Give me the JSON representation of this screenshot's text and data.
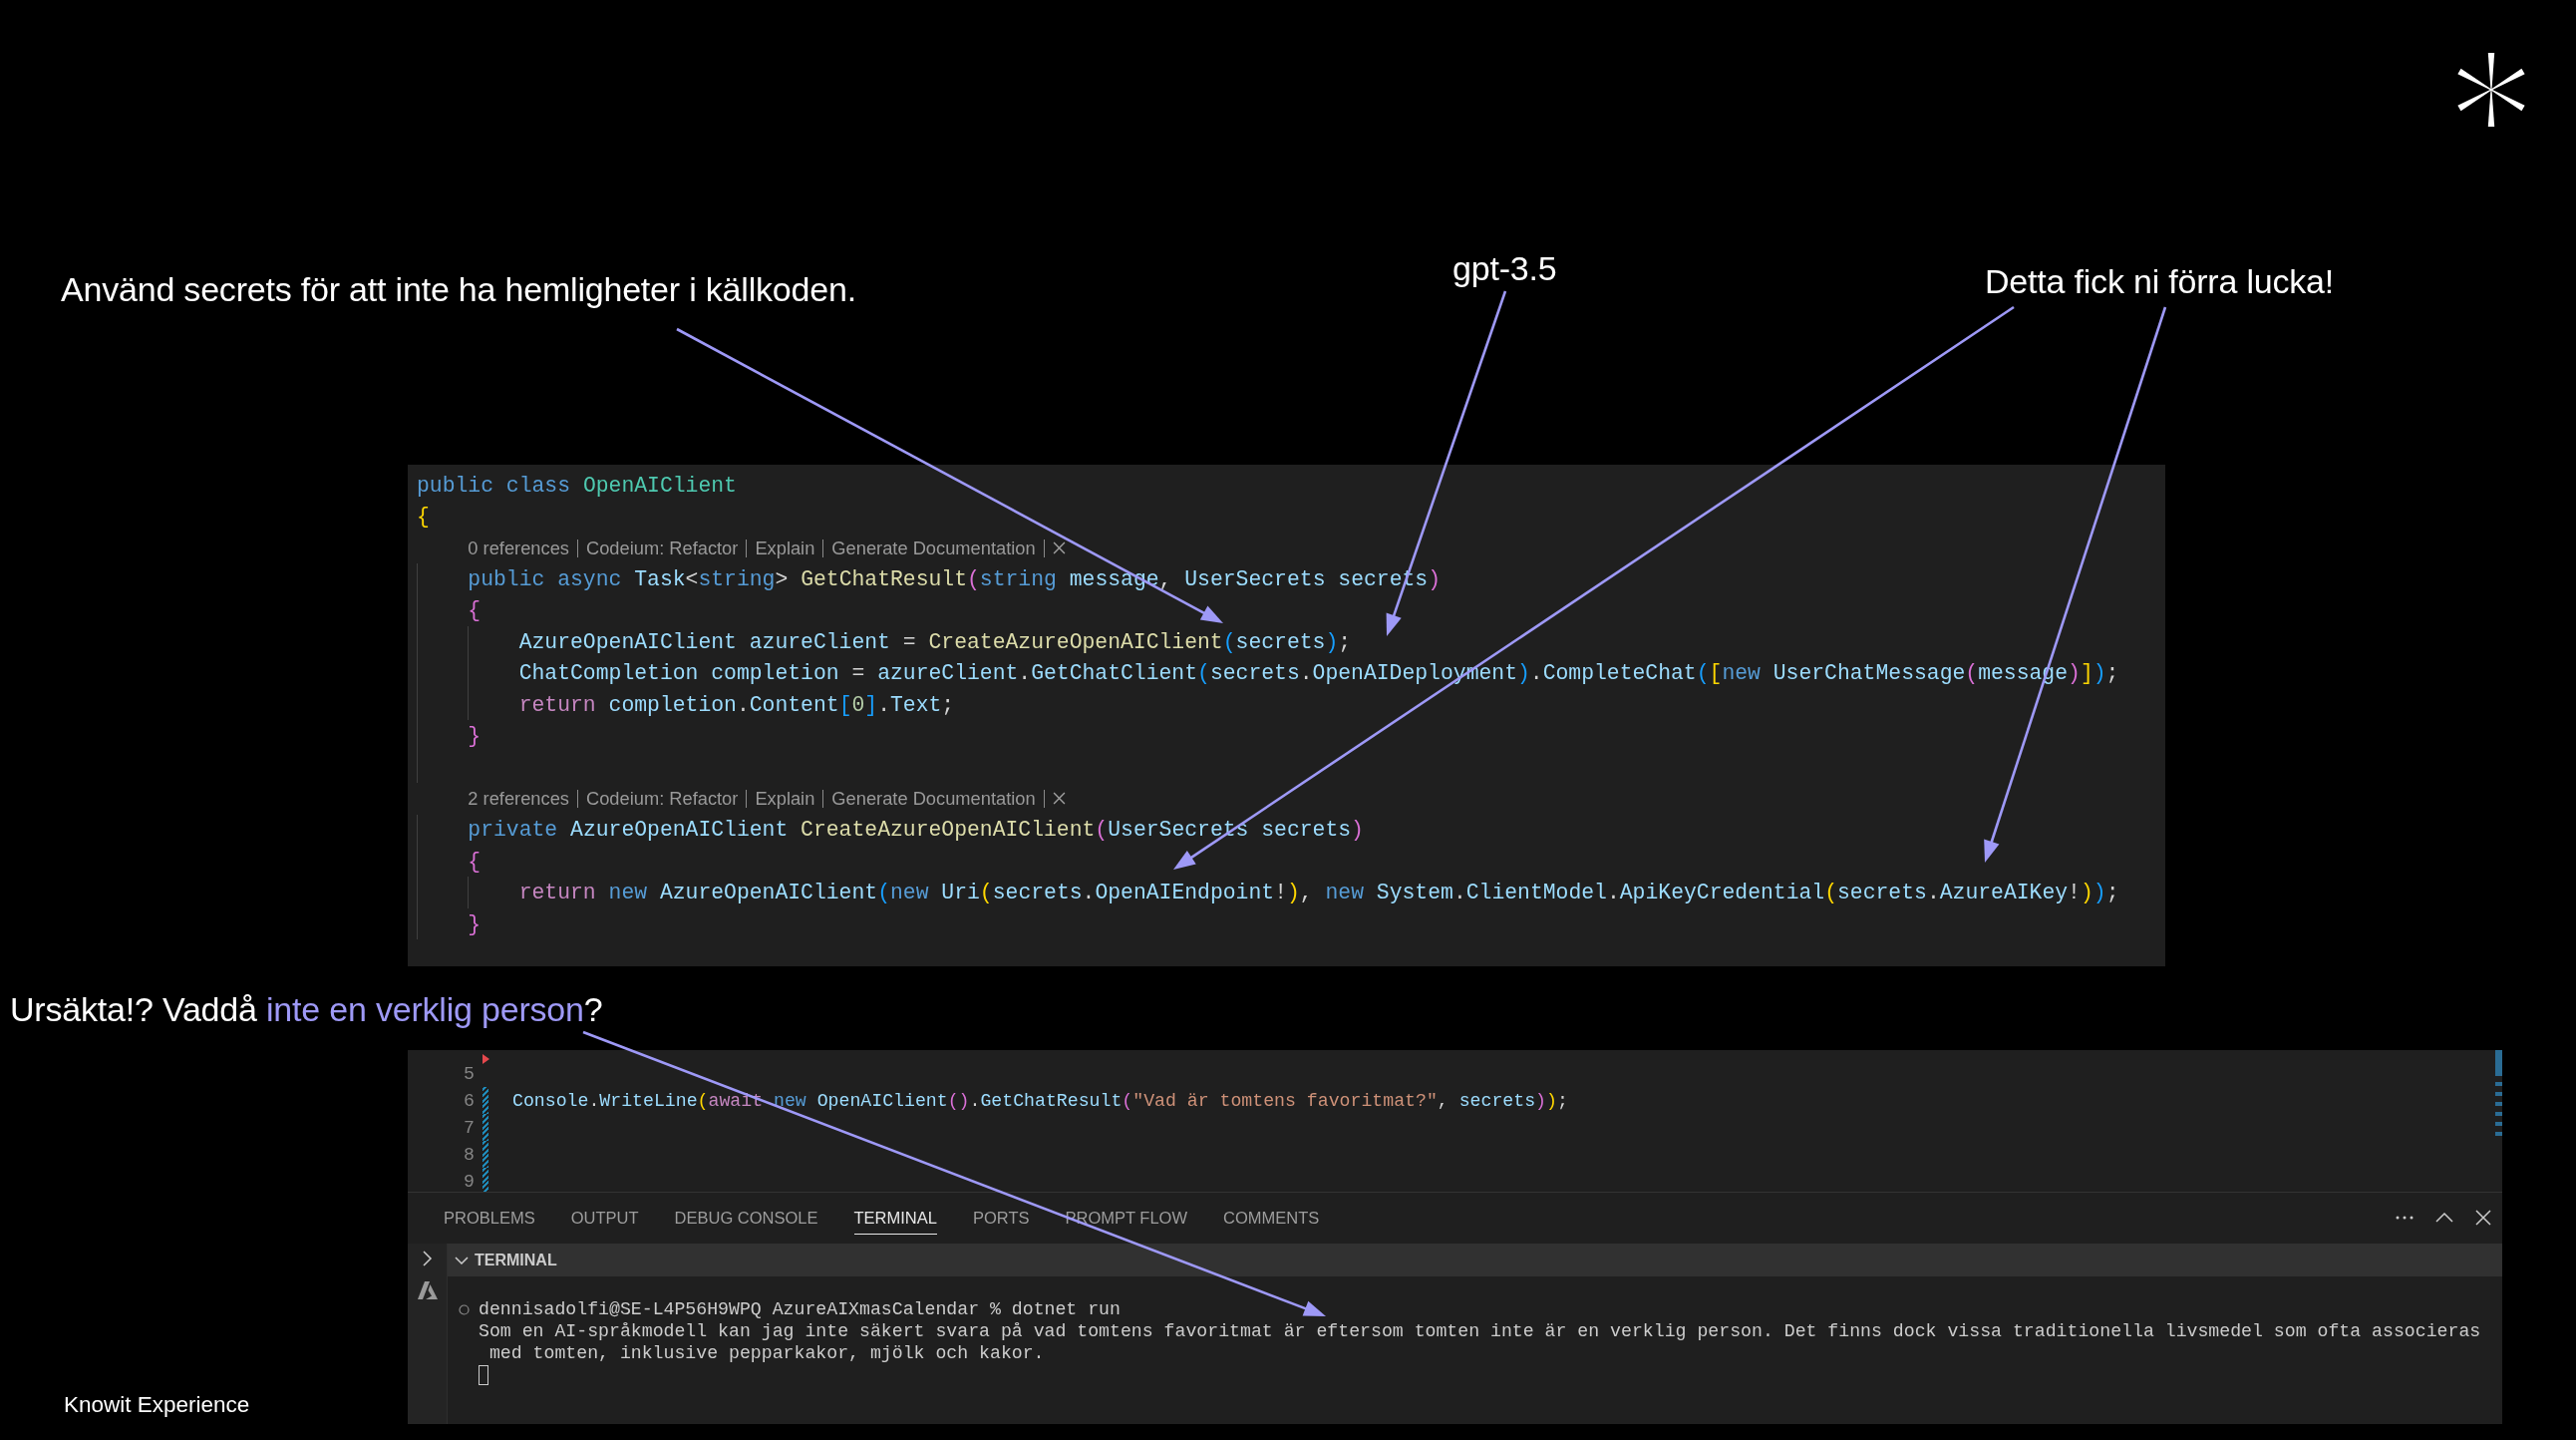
{
  "annotations": [
    "Använd secrets för att inte ha hemligheter i källkoden.",
    "gpt-3.5",
    "Detta fick ni förra lucka!"
  ],
  "code_panel": {
    "lines": [
      {
        "kind": "code",
        "tokens": [
          {
            "text": "public class ",
            "kind": "keyword"
          },
          {
            "text": "OpenAIClient",
            "kind": "class"
          }
        ]
      },
      {
        "kind": "code",
        "tokens": [
          {
            "text": "{",
            "kind": "bracket1"
          }
        ],
        "children": [
          {
            "kind": "codelens",
            "actions": [
              "0 references",
              "Codeium: Refactor",
              "Explain",
              "Generate Documentation"
            ]
          },
          {
            "kind": "code",
            "tokens": [
              {
                "text": "public async ",
                "kind": "keyword"
              },
              {
                "text": "Task",
                "kind": "identifier"
              },
              {
                "text": "<",
                "kind": "punct"
              },
              {
                "text": "string",
                "kind": "keyword"
              },
              {
                "text": "> ",
                "kind": "punct"
              },
              {
                "text": "GetChatResult",
                "kind": "function"
              },
              {
                "text": "(",
                "kind": "bracket2"
              },
              {
                "text": "string ",
                "kind": "keyword"
              },
              {
                "text": "message",
                "kind": "identifier"
              },
              {
                "text": ", ",
                "kind": "punct"
              },
              {
                "text": "UserSecrets secrets",
                "kind": "identifier"
              },
              {
                "text": ")",
                "kind": "bracket2"
              }
            ]
          },
          {
            "kind": "code",
            "tokens": [
              {
                "text": "{",
                "kind": "bracket2"
              }
            ],
            "children": [
              {
                "kind": "code",
                "tokens": [
                  {
                    "text": "AzureOpenAIClient azureClient",
                    "kind": "identifier"
                  },
                  {
                    "text": " = ",
                    "kind": "punct"
                  },
                  {
                    "text": "CreateAzureOpenAIClient",
                    "kind": "function"
                  },
                  {
                    "text": "(",
                    "kind": "bracket3"
                  },
                  {
                    "text": "secrets",
                    "kind": "identifier"
                  },
                  {
                    "text": ")",
                    "kind": "bracket3"
                  },
                  {
                    "text": ";",
                    "kind": "punct"
                  }
                ]
              },
              {
                "kind": "code",
                "tokens": [
                  {
                    "text": "ChatCompletion completion",
                    "kind": "identifier"
                  },
                  {
                    "text": " = ",
                    "kind": "punct"
                  },
                  {
                    "text": "azureClient",
                    "kind": "identifier"
                  },
                  {
                    "text": ".",
                    "kind": "punct"
                  },
                  {
                    "text": "GetChatClient",
                    "kind": "identifier"
                  },
                  {
                    "text": "(",
                    "kind": "bracket3"
                  },
                  {
                    "text": "secrets",
                    "kind": "identifier"
                  },
                  {
                    "text": ".",
                    "kind": "punct"
                  },
                  {
                    "text": "OpenAIDeployment",
                    "kind": "identifier"
                  },
                  {
                    "text": ")",
                    "kind": "bracket3"
                  },
                  {
                    "text": ".",
                    "kind": "punct"
                  },
                  {
                    "text": "CompleteChat",
                    "kind": "identifier"
                  },
                  {
                    "text": "(",
                    "kind": "bracket3"
                  },
                  {
                    "text": "[",
                    "kind": "bracket1"
                  },
                  {
                    "text": "new ",
                    "kind": "keyword"
                  },
                  {
                    "text": "UserChatMessage",
                    "kind": "identifier"
                  },
                  {
                    "text": "(",
                    "kind": "bracket2"
                  },
                  {
                    "text": "message",
                    "kind": "identifier"
                  },
                  {
                    "text": ")",
                    "kind": "bracket2"
                  },
                  {
                    "text": "]",
                    "kind": "bracket1"
                  },
                  {
                    "text": ")",
                    "kind": "bracket3"
                  },
                  {
                    "text": ";",
                    "kind": "punct"
                  }
                ]
              },
              {
                "kind": "code",
                "tokens": [
                  {
                    "text": "return ",
                    "kind": "control"
                  },
                  {
                    "text": "completion",
                    "kind": "identifier"
                  },
                  {
                    "text": ".",
                    "kind": "punct"
                  },
                  {
                    "text": "Content",
                    "kind": "identifier"
                  },
                  {
                    "text": "[",
                    "kind": "bracket3"
                  },
                  {
                    "text": "0",
                    "kind": "number"
                  },
                  {
                    "text": "]",
                    "kind": "bracket3"
                  },
                  {
                    "text": ".",
                    "kind": "punct"
                  },
                  {
                    "text": "Text",
                    "kind": "identifier"
                  },
                  {
                    "text": ";",
                    "kind": "punct"
                  }
                ]
              }
            ]
          },
          {
            "kind": "code",
            "tokens": [
              {
                "text": "}",
                "kind": "bracket2"
              }
            ]
          },
          {
            "kind": "blank"
          },
          {
            "kind": "codelens",
            "actions": [
              "2 references",
              "Codeium: Refactor",
              "Explain",
              "Generate Documentation"
            ]
          },
          {
            "kind": "code",
            "tokens": [
              {
                "text": "private ",
                "kind": "keyword"
              },
              {
                "text": "AzureOpenAIClient ",
                "kind": "identifier"
              },
              {
                "text": "CreateAzureOpenAIClient",
                "kind": "function"
              },
              {
                "text": "(",
                "kind": "bracket2"
              },
              {
                "text": "UserSecrets secrets",
                "kind": "identifier"
              },
              {
                "text": ")",
                "kind": "bracket2"
              }
            ]
          },
          {
            "kind": "code",
            "tokens": [
              {
                "text": "{",
                "kind": "bracket2"
              }
            ],
            "children": [
              {
                "kind": "code",
                "tokens": [
                  {
                    "text": "return ",
                    "kind": "control"
                  },
                  {
                    "text": "new ",
                    "kind": "keyword"
                  },
                  {
                    "text": "AzureOpenAIClient",
                    "kind": "identifier"
                  },
                  {
                    "text": "(",
                    "kind": "bracket3"
                  },
                  {
                    "text": "new ",
                    "kind": "keyword"
                  },
                  {
                    "text": "Uri",
                    "kind": "identifier"
                  },
                  {
                    "text": "(",
                    "kind": "bracket1"
                  },
                  {
                    "text": "secrets",
                    "kind": "identifier"
                  },
                  {
                    "text": ".",
                    "kind": "punct"
                  },
                  {
                    "text": "OpenAIEndpoint",
                    "kind": "identifier"
                  },
                  {
                    "text": "!",
                    "kind": "punct"
                  },
                  {
                    "text": ")",
                    "kind": "bracket1"
                  },
                  {
                    "text": ", ",
                    "kind": "punct"
                  },
                  {
                    "text": "new ",
                    "kind": "keyword"
                  },
                  {
                    "text": "System",
                    "kind": "identifier"
                  },
                  {
                    "text": ".",
                    "kind": "punct"
                  },
                  {
                    "text": "ClientModel",
                    "kind": "identifier"
                  },
                  {
                    "text": ".",
                    "kind": "punct"
                  },
                  {
                    "text": "ApiKeyCredential",
                    "kind": "identifier"
                  },
                  {
                    "text": "(",
                    "kind": "bracket1"
                  },
                  {
                    "text": "secrets",
                    "kind": "identifier"
                  },
                  {
                    "text": ".",
                    "kind": "punct"
                  },
                  {
                    "text": "AzureAIKey",
                    "kind": "identifier"
                  },
                  {
                    "text": "!",
                    "kind": "punct"
                  },
                  {
                    "text": ")",
                    "kind": "bracket1"
                  },
                  {
                    "text": ")",
                    "kind": "bracket3"
                  },
                  {
                    "text": ";",
                    "kind": "punct"
                  }
                ]
              }
            ]
          },
          {
            "kind": "code",
            "tokens": [
              {
                "text": "}",
                "kind": "bracket2"
              }
            ]
          }
        ]
      }
    ]
  },
  "remark": {
    "parts": [
      {
        "text": "Ursäkta!? Vaddå ",
        "highlight": false
      },
      {
        "text": "inte en verklig person",
        "highlight": true
      },
      {
        "text": "?",
        "highlight": false
      }
    ]
  },
  "editor": {
    "lines": [
      {
        "number": "5",
        "modified": false,
        "deleted_above": true
      },
      {
        "number": "6",
        "modified": true,
        "deleted_above": false,
        "tokens": [
          {
            "text": "Console",
            "kind": "identifier"
          },
          {
            "text": ".",
            "kind": "punct"
          },
          {
            "text": "WriteLine",
            "kind": "identifier"
          },
          {
            "text": "(",
            "kind": "bracket1"
          },
          {
            "text": "await ",
            "kind": "control"
          },
          {
            "text": "new ",
            "kind": "keyword"
          },
          {
            "text": "OpenAIClient",
            "kind": "identifier"
          },
          {
            "text": "()",
            "kind": "bracket2"
          },
          {
            "text": ".",
            "kind": "punct"
          },
          {
            "text": "GetChatResult",
            "kind": "identifier"
          },
          {
            "text": "(",
            "kind": "bracket2"
          },
          {
            "text": "\"Vad är tomtens favoritmat?\"",
            "kind": "string"
          },
          {
            "text": ", ",
            "kind": "punct"
          },
          {
            "text": "secrets",
            "kind": "identifier"
          },
          {
            "text": ")",
            "kind": "bracket2"
          },
          {
            "text": ")",
            "kind": "bracket1"
          },
          {
            "text": ";",
            "kind": "punct"
          }
        ]
      },
      {
        "number": "7",
        "modified": true,
        "deleted_above": false
      },
      {
        "number": "8",
        "modified": true,
        "deleted_above": false
      },
      {
        "number": "9",
        "modified": true,
        "deleted_above": false
      }
    ]
  },
  "panel": {
    "tabs": [
      {
        "label": "PROBLEMS",
        "selected": false
      },
      {
        "label": "OUTPUT",
        "selected": false
      },
      {
        "label": "DEBUG CONSOLE",
        "selected": false
      },
      {
        "label": "TERMINAL",
        "selected": true
      },
      {
        "label": "PORTS",
        "selected": false
      },
      {
        "label": "PROMPT FLOW",
        "selected": false
      },
      {
        "label": "COMMENTS",
        "selected": false
      }
    ],
    "terminal": {
      "title": "TERMINAL",
      "expanded": true,
      "lines": [
        {
          "kind": "command",
          "text": "dennisadolfi@SE-L4P56H9WPQ AzureAIXmasCalendar % dotnet run"
        },
        {
          "kind": "output",
          "text": "Som en AI-språkmodell kan jag inte säkert svara på vad tomtens favoritmat är eftersom tomten inte är en verklig person. Det finns dock vissa traditionella livsmedel som ofta associeras"
        },
        {
          "kind": "wrapped",
          "text": "med tomten, inklusive pepparkakor, mjölk och kakor."
        }
      ],
      "cursor": true
    }
  },
  "footer": "Knowit Experience"
}
